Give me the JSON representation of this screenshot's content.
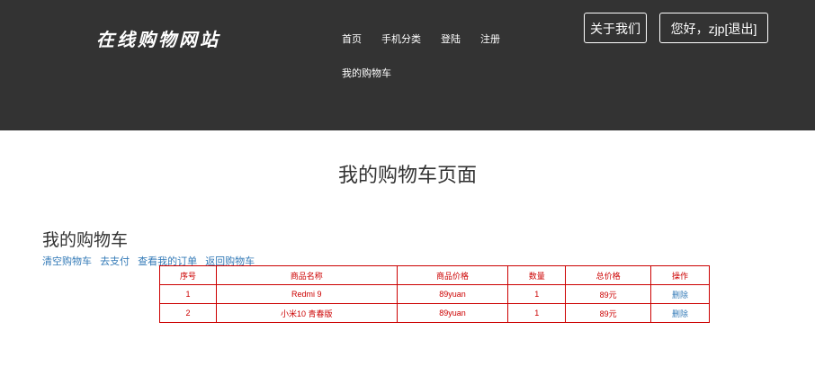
{
  "header": {
    "logo": "在线购物网站",
    "nav": [
      "首页",
      "手机分类",
      "登陆",
      "注册"
    ],
    "cart_link": "我的购物车",
    "about_button": "关于我们",
    "user_button": "您好，zjp[退出]"
  },
  "main": {
    "page_title": "我的购物车页面",
    "cart_heading": "我的购物车",
    "actions": [
      "清空购物车",
      "去支付",
      "查看我的订单",
      "返回购物车"
    ]
  },
  "table": {
    "headers": [
      "序号",
      "商品名称",
      "商品价格",
      "数量",
      "总价格",
      "操作"
    ],
    "rows": [
      [
        "1",
        "Redmi 9",
        "89yuan",
        "1",
        "89元",
        "删除"
      ],
      [
        "2",
        "小米10 青春版",
        "89yuan",
        "1",
        "89元",
        "删除"
      ]
    ]
  },
  "colors": {
    "header_bg": "#333333",
    "table_border": "#cc0000",
    "link": "#337ab7"
  }
}
